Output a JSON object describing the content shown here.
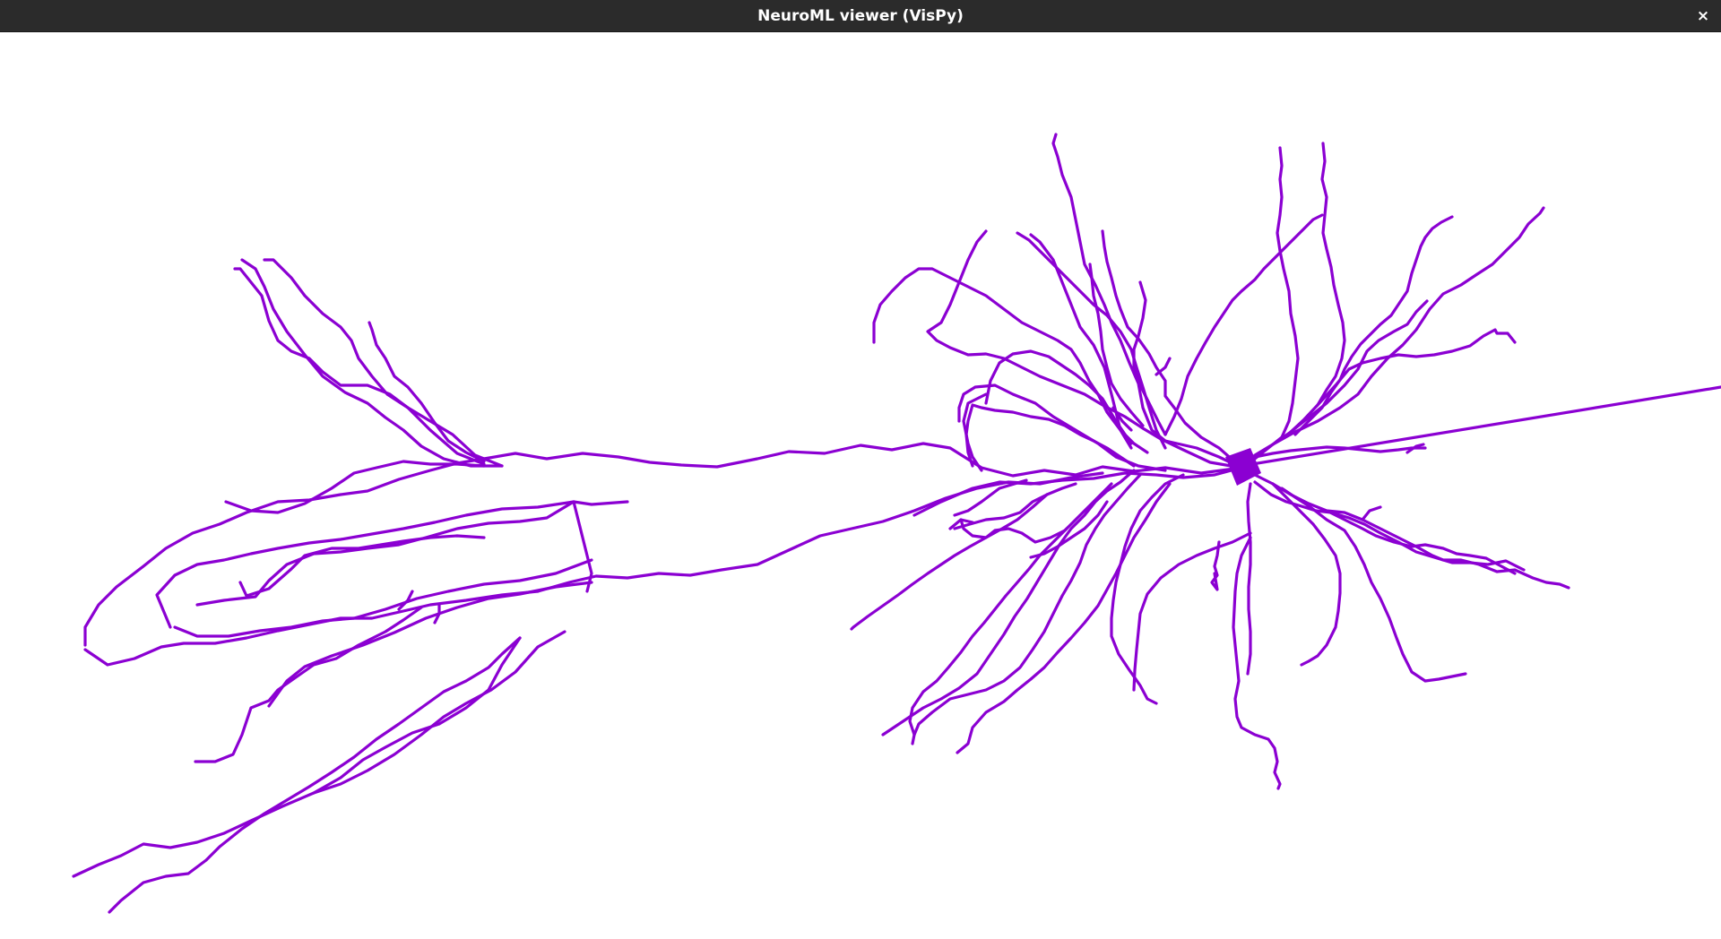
{
  "window": {
    "title": "NeuroML viewer (VisPy)",
    "close_glyph": "×",
    "close_icon": "close-icon"
  },
  "scene": {
    "background": "#ffffff",
    "neuron_color": "#8b00d2"
  }
}
